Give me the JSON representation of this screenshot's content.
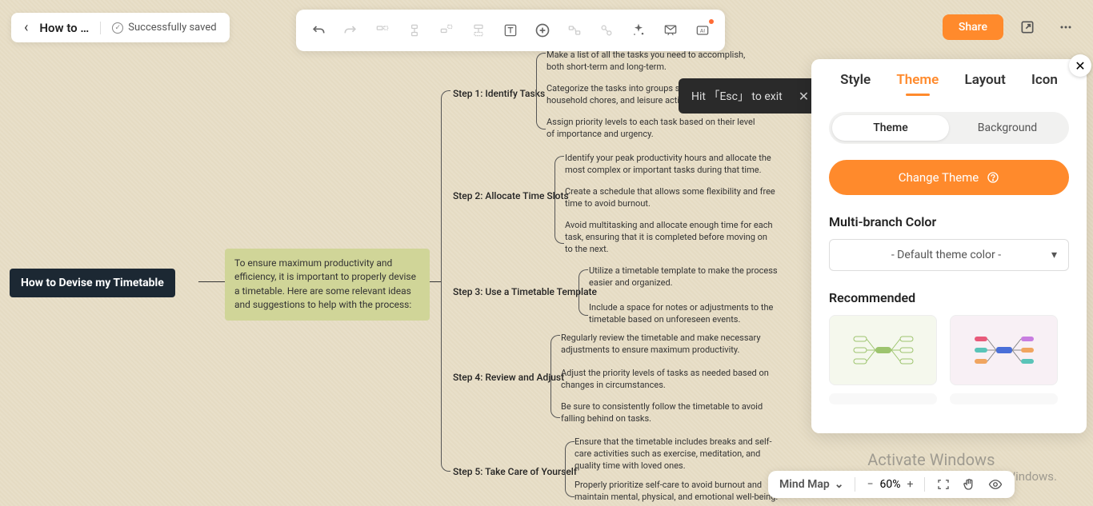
{
  "header": {
    "doc_title": "How to …",
    "save_status": "Successfully saved"
  },
  "topright": {
    "share": "Share"
  },
  "hint": {
    "text": "Hit 「Esc」 to  exit"
  },
  "panel": {
    "tabs": {
      "style": "Style",
      "theme": "Theme",
      "layout": "Layout",
      "icon": "Icon"
    },
    "subtabs": {
      "theme": "Theme",
      "background": "Background"
    },
    "change_theme": "Change Theme",
    "multibranch": "Multi-branch Color",
    "dropdown_value": "- Default theme color -",
    "recommended": "Recommended"
  },
  "mindmap": {
    "root": "How to Devise my Timetable",
    "desc": "To ensure maximum productivity and efficiency, it is important to properly devise a timetable. Here are some relevant ideas and suggestions to help with the process:",
    "steps": [
      {
        "label": "Step 1: Identify Tasks",
        "details": [
          "Make a list of all the tasks you need to accomplish, both short-term and long-term.",
          "Categorize the tasks into groups such as work, household chores, and leisure activities.",
          "Assign priority levels to each task based on their level of importance and urgency."
        ]
      },
      {
        "label": "Step 2: Allocate Time Slots",
        "details": [
          "Identify your peak productivity hours and allocate the most complex or important tasks during that time.",
          "Create a schedule that allows some flexibility and free time to avoid burnout.",
          "Avoid multitasking and allocate enough time for each task, ensuring that it is completed before moving on to the next."
        ]
      },
      {
        "label": "Step 3: Use a Timetable Template",
        "details": [
          "Utilize a timetable template to make the process easier and organized.",
          "Include a space for notes or adjustments to the timetable based on unforeseen events."
        ]
      },
      {
        "label": "Step 4: Review and Adjust",
        "details": [
          "Regularly review the timetable and make necessary adjustments to ensure maximum productivity.",
          "Adjust the priority levels of tasks as needed based on changes in circumstances.",
          "Be sure to consistently follow the timetable to avoid falling behind on tasks."
        ]
      },
      {
        "label": "Step 5: Take Care of Yourself",
        "details": [
          "Ensure that the timetable includes breaks and self-care activities such as exercise, meditation, and quality time with loved ones.",
          "Properly prioritize self-care to avoid burnout and maintain mental, physical, and emotional well-being."
        ]
      }
    ]
  },
  "bottom": {
    "mode": "Mind Map",
    "zoom": "60%"
  },
  "watermark": {
    "line1": "Activate Windows",
    "line2": "Go to Settings to activate Windows."
  }
}
